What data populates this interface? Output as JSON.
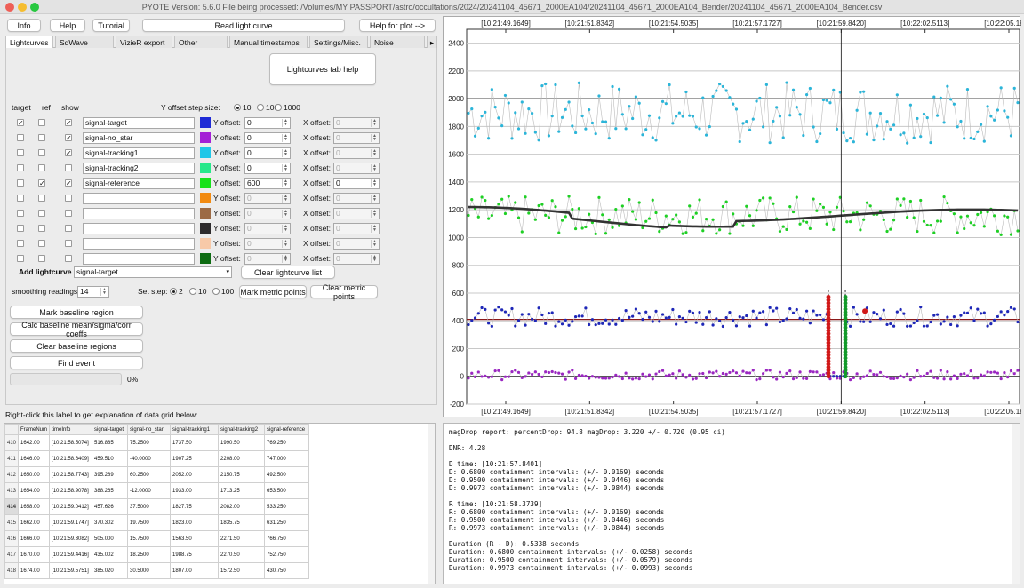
{
  "window": {
    "title": "PYOTE Version: 5.6.0  File being processed: /Volumes/MY PASSPORT/astro/occultations/2024/20241104_45671_2000EA104/20241104_45671_2000EA104_Bender/20241104_45671_2000EA104_Bender.csv"
  },
  "top_buttons": {
    "info": "Info",
    "help": "Help",
    "tutorial": "Tutorial",
    "read_light_curve": "Read light curve",
    "help_for_plot": "Help for plot -->"
  },
  "tabs": [
    "Lightcurves",
    "SqWave model",
    "VizieR export",
    "Other models",
    "Manual timestamps",
    "Settings/Misc.",
    "Noise analysis/"
  ],
  "lightcurves_tab": {
    "help_button": "Lightcurves tab help",
    "col_target": "target",
    "col_ref": "ref",
    "col_show": "show",
    "y_offset_step_label": "Y offset step size:",
    "y_offset_steps": [
      "10",
      "100",
      "1000"
    ],
    "y_offset_label": "Y offset:",
    "x_offset_label": "X offset:",
    "rows": [
      {
        "name": "signal-target",
        "color": "#1f2bd6",
        "target": true,
        "ref": false,
        "show": true,
        "y": "0",
        "x": "0",
        "enabled": true,
        "x_enabled": false
      },
      {
        "name": "signal-no_star",
        "color": "#a41fd6",
        "target": false,
        "ref": false,
        "show": true,
        "y": "0",
        "x": "0",
        "enabled": true,
        "x_enabled": false
      },
      {
        "name": "signal-tracking1",
        "color": "#1fc7e8",
        "target": false,
        "ref": false,
        "show": true,
        "y": "0",
        "x": "0",
        "enabled": true,
        "x_enabled": false
      },
      {
        "name": "signal-tracking2",
        "color": "#27e88a",
        "target": false,
        "ref": false,
        "show": false,
        "y": "0",
        "x": "0",
        "enabled": true,
        "x_enabled": false
      },
      {
        "name": "signal-reference",
        "color": "#17e21a",
        "target": false,
        "ref": true,
        "show": true,
        "y": "600",
        "x": "0",
        "enabled": true,
        "x_enabled": true
      },
      {
        "name": "",
        "color": "#f28a10",
        "target": false,
        "ref": false,
        "show": false,
        "y": "0",
        "x": "0",
        "enabled": false,
        "x_enabled": false
      },
      {
        "name": "",
        "color": "#9c6a44",
        "target": false,
        "ref": false,
        "show": false,
        "y": "0",
        "x": "0",
        "enabled": false,
        "x_enabled": false
      },
      {
        "name": "",
        "color": "#2d2b2c",
        "target": false,
        "ref": false,
        "show": false,
        "y": "0",
        "x": "0",
        "enabled": false,
        "x_enabled": false
      },
      {
        "name": "",
        "color": "#f7c9a8",
        "target": false,
        "ref": false,
        "show": false,
        "y": "0",
        "x": "0",
        "enabled": false,
        "x_enabled": false
      },
      {
        "name": "",
        "color": "#0d6b11",
        "target": false,
        "ref": false,
        "show": false,
        "y": "0",
        "x": "0",
        "enabled": false,
        "x_enabled": false
      }
    ],
    "add_lightcurve_label": "Add lightcurve",
    "add_lightcurve_value": "signal-target",
    "clear_list_button": "Clear lightcurve list",
    "smoothing_label": "smoothing readings",
    "smoothing_value": "14",
    "set_step_label": "Set step:",
    "set_steps": [
      "2",
      "10",
      "100"
    ],
    "mark_metric_button": "Mark metric points",
    "clear_metric_button": "Clear metric points",
    "mark_baseline_button": "Mark baseline region",
    "calc_baseline_button": "Calc baseline mean/sigma/corr coeffs",
    "clear_baseline_button": "Clear baseline regions",
    "find_event_button": "Find event",
    "progress_percent": "0%"
  },
  "grid": {
    "label": "Right-click this label to get explanation of data grid below:",
    "columns": [
      "FrameNum",
      "timeInfo",
      "signal-target",
      "signal-no_star",
      "signal-tracking1",
      "signal-tracking2",
      "signal-reference"
    ],
    "rows": [
      {
        "rn": "410",
        "cells": [
          "1642.00",
          "[10:21:58.5074]",
          "516.885",
          "75.2500",
          "1737.50",
          "1990.50",
          "769.250"
        ]
      },
      {
        "rn": "411",
        "cells": [
          "1646.00",
          "[10:21:58.6409]",
          "459.510",
          "-40.0000",
          "1907.25",
          "2208.00",
          "747.000"
        ]
      },
      {
        "rn": "412",
        "cells": [
          "1650.00",
          "[10:21:58.7743]",
          "395.289",
          "60.2500",
          "2052.00",
          "2150.75",
          "492.500"
        ]
      },
      {
        "rn": "413",
        "cells": [
          "1654.00",
          "[10:21:58.9078]",
          "388.265",
          "-12.0000",
          "1933.00",
          "1713.25",
          "653.500"
        ]
      },
      {
        "rn": "414",
        "cells": [
          "1658.00",
          "[10:21:59.0412]",
          "457.626",
          "37.5000",
          "1827.75",
          "2082.00",
          "533.250"
        ]
      },
      {
        "rn": "415",
        "cells": [
          "1662.00",
          "[10:21:59.1747]",
          "370.302",
          "19.7500",
          "1823.00",
          "1835.75",
          "631.250"
        ]
      },
      {
        "rn": "416",
        "cells": [
          "1666.00",
          "[10:21:59.3082]",
          "505.000",
          "15.7500",
          "1563.50",
          "2271.50",
          "766.750"
        ]
      },
      {
        "rn": "417",
        "cells": [
          "1670.00",
          "[10:21:59.4416]",
          "435.002",
          "18.2500",
          "1988.75",
          "2270.50",
          "752.750"
        ]
      },
      {
        "rn": "418",
        "cells": [
          "1674.00",
          "[10:21:59.5751]",
          "385.020",
          "30.5000",
          "1807.00",
          "1572.50",
          "430.750"
        ]
      }
    ]
  },
  "report": {
    "lines": [
      "magDrop report: percentDrop: 94.8 magDrop: 3.220 +/- 0.720 (0.95 ci)",
      "",
      "DNR: 4.28",
      "",
      "D time: [10:21:57.8401]",
      "D: 0.6800 containment intervals: (+/- 0.0169) seconds",
      "D: 0.9500 containment intervals: (+/- 0.0446) seconds",
      "D: 0.9973 containment intervals: (+/- 0.0844) seconds",
      "",
      "R time: [10:21:58.3739]",
      "R: 0.6800 containment intervals: (+/- 0.0169) seconds",
      "R: 0.9500 containment intervals: (+/- 0.0446) seconds",
      "R: 0.9973 containment intervals: (+/- 0.0844) seconds",
      "",
      "Duration (R - D): 0.5338 seconds",
      "Duration: 0.6800 containment intervals: (+/- 0.0258) seconds",
      "Duration: 0.9500 containment intervals: (+/- 0.0579) seconds",
      "Duration: 0.9973 containment intervals: (+/- 0.0993) seconds"
    ]
  },
  "chart_data": {
    "type": "scatter",
    "top_ticks": [
      "[10:21:49.1649]",
      "[10:21:51.8342]",
      "[10:21:54.5035]",
      "[10:21:57.1727]",
      "[10:21:59.8420]",
      "[10:22:02.5113]",
      "[10:22:05.1806]"
    ],
    "bottom_ticks": [
      "[10:21:49.1649]",
      "[10:21:51.8342]",
      "[10:21:54.5035]",
      "[10:21:57.1727]",
      "[10:21:59.8420]",
      "[10:22:02.5113]",
      "[10:22:05.1806]"
    ],
    "y_ticks": [
      2400,
      2200,
      2000,
      1800,
      1600,
      1400,
      1200,
      1000,
      800,
      600,
      400,
      200,
      0,
      -200
    ],
    "ylim": [
      -200,
      2500
    ],
    "grid": true,
    "baselines": [
      2000,
      410,
      0
    ],
    "cursor_label": "[10:21:59.8420]",
    "series": [
      {
        "name": "signal-tracking1",
        "color": "#2bb5d9",
        "level": 1900,
        "spread": 220
      },
      {
        "name": "signal-reference",
        "color": "#1ed024",
        "level": 1160,
        "spread": 140
      },
      {
        "name": "signal-target",
        "color": "#1e27b8",
        "level": 430,
        "spread": 70
      },
      {
        "name": "signal-no_star",
        "color": "#9b27c2",
        "level": 10,
        "spread": 35
      }
    ],
    "smoothed_color": "#333333",
    "event_D_color": "#d11919",
    "event_R_color": "#139a2a"
  }
}
